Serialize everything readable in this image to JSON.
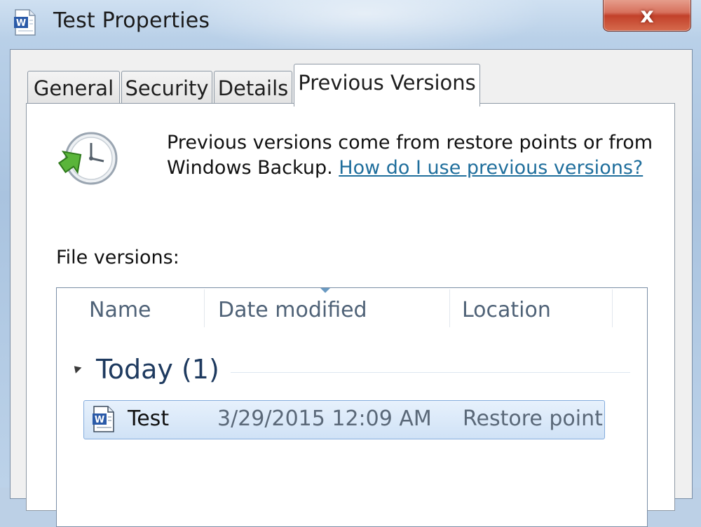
{
  "window": {
    "title": "Test Properties",
    "app_icon": "word-document-icon",
    "close_label": "x"
  },
  "tabs": [
    {
      "label": "General",
      "active": false
    },
    {
      "label": "Security",
      "active": false
    },
    {
      "label": "Details",
      "active": false
    },
    {
      "label": "Previous Versions",
      "active": true
    }
  ],
  "info": {
    "icon": "restore-clock-icon",
    "text": "Previous versions come from restore points or from Windows Backup.",
    "link": "How do I use previous versions?"
  },
  "file_versions": {
    "label": "File versions:",
    "columns": [
      "Name",
      "Date modified",
      "Location"
    ],
    "group": {
      "title": "Today (1)",
      "expanded": true
    },
    "rows": [
      {
        "name": "Test",
        "date_modified": "3/29/2015 12:09 AM",
        "location": "Restore point",
        "icon": "word-document-icon",
        "selected": true
      }
    ]
  },
  "colors": {
    "link": "#1f6e9c",
    "group_title": "#1e3a5f",
    "selected_row": "#d0e2f6",
    "close_button": "#c2412a"
  }
}
